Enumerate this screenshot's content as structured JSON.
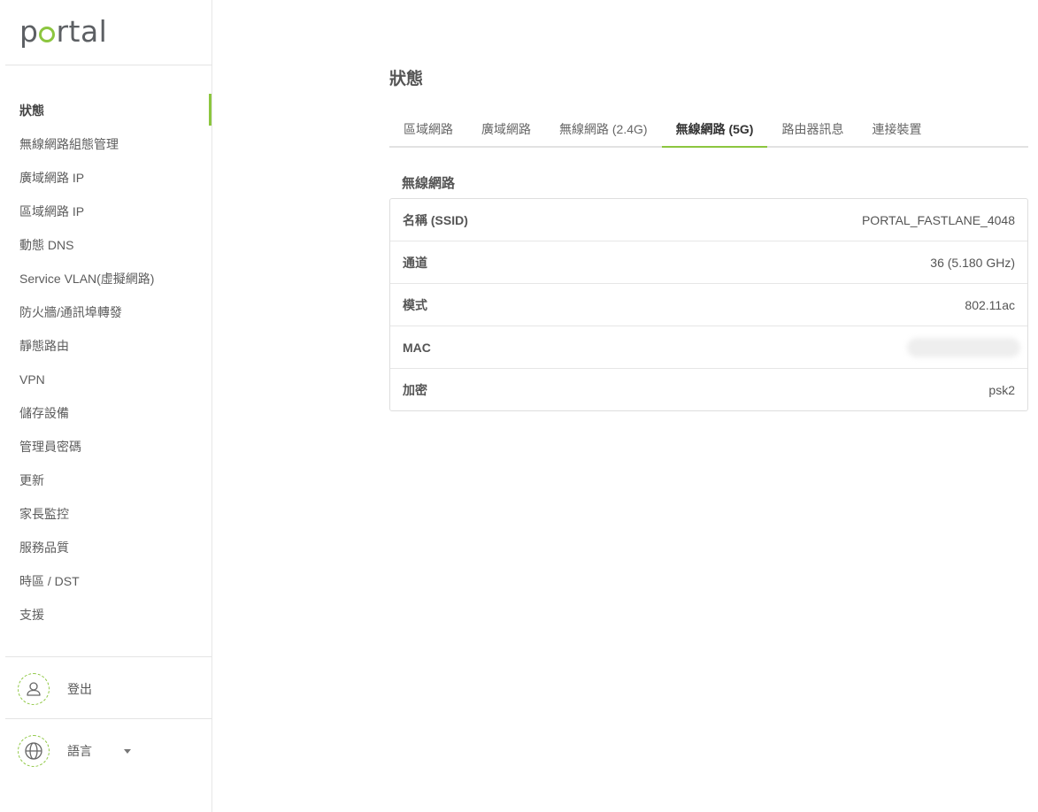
{
  "brand": {
    "logo_before": "p",
    "logo_after": "rtal",
    "accent_color": "#8cc63f"
  },
  "sidebar": {
    "items": [
      {
        "label": "狀態",
        "active": true
      },
      {
        "label": "無線網路組態管理"
      },
      {
        "label": "廣域網路 IP"
      },
      {
        "label": "區域網路 IP"
      },
      {
        "label": "動態 DNS"
      },
      {
        "label": "Service VLAN(虛擬網路)"
      },
      {
        "label": "防火牆/通訊埠轉發"
      },
      {
        "label": "靜態路由"
      },
      {
        "label": "VPN"
      },
      {
        "label": "儲存設備"
      },
      {
        "label": "管理員密碼"
      },
      {
        "label": "更新"
      },
      {
        "label": "家長監控"
      },
      {
        "label": "服務品質"
      },
      {
        "label": "時區 / DST"
      },
      {
        "label": "支援"
      }
    ],
    "logout": {
      "label": "登出",
      "icon": "user-icon"
    },
    "language": {
      "label": "語言",
      "icon": "globe-icon"
    }
  },
  "main": {
    "title": "狀態",
    "tabs": [
      {
        "label": "區域網路"
      },
      {
        "label": "廣域網路"
      },
      {
        "label": "無線網路 (2.4G)"
      },
      {
        "label": "無線網路 (5G)",
        "active": true
      },
      {
        "label": "路由器訊息"
      },
      {
        "label": "連接裝置"
      }
    ],
    "section_title": "無線網路",
    "rows": [
      {
        "key": "名稱 (SSID)",
        "value": "PORTAL_FASTLANE_4048"
      },
      {
        "key": "通道",
        "value": "36 (5.180 GHz)"
      },
      {
        "key": "模式",
        "value": "802.11ac"
      },
      {
        "key": "MAC",
        "value": "",
        "redacted": true
      },
      {
        "key": "加密",
        "value": "psk2"
      }
    ]
  }
}
